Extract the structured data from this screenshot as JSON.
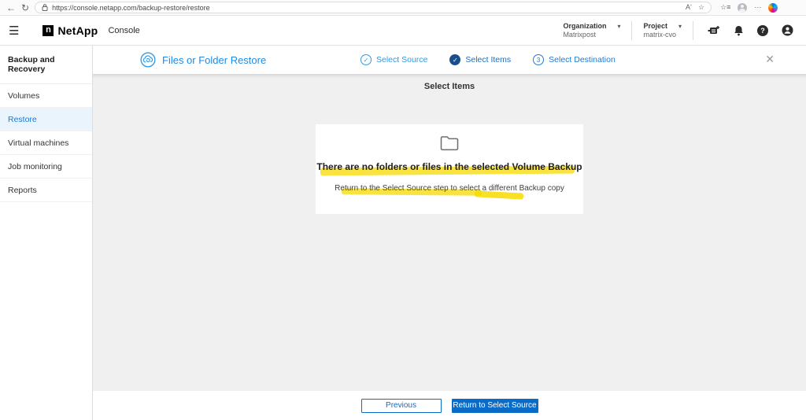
{
  "browser": {
    "url": "https://console.netapp.com/backup-restore/restore"
  },
  "header": {
    "brand": "NetApp",
    "brand_mark": "n",
    "product": "Console",
    "organization_label": "Organization",
    "organization_value": "Matrixpost",
    "project_label": "Project",
    "project_value": "matrix-cvo",
    "help_glyph": "?"
  },
  "sidebar": {
    "title": "Backup and Recovery",
    "items": [
      {
        "label": "Volumes",
        "active": false
      },
      {
        "label": "Restore",
        "active": true
      },
      {
        "label": "Virtual machines",
        "active": false
      },
      {
        "label": "Job monitoring",
        "active": false
      },
      {
        "label": "Reports",
        "active": false
      }
    ]
  },
  "wizard": {
    "title": "Files or Folder Restore",
    "steps": [
      {
        "label": "Select Source",
        "state": "completed",
        "glyph": "✓"
      },
      {
        "label": "Select Items",
        "state": "active",
        "glyph": "✓"
      },
      {
        "label": "Select Destination",
        "state": "upcoming",
        "glyph": "3"
      }
    ]
  },
  "main": {
    "page_title": "Select Items",
    "empty_state": {
      "title": "There are no folders or files in the selected Volume Backup",
      "subtitle": "Return to the Select Source step to select a different Backup copy"
    }
  },
  "footer": {
    "previous_label": "Previous",
    "primary_label": "Return to Select Source"
  },
  "colors": {
    "accent_blue": "#1d8be4",
    "active_step_blue": "#1a4f8e",
    "primary_button_blue": "#0b6cc8",
    "highlight_yellow": "#f7da00",
    "sidebar_active_bg": "#eaf4fc",
    "workarea_gray": "#f0f0f0"
  }
}
